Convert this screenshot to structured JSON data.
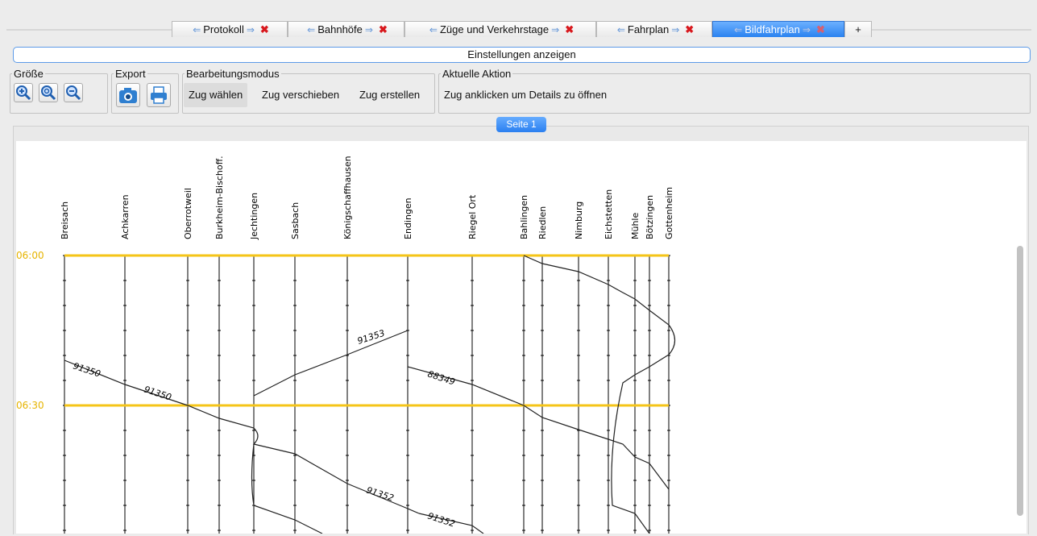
{
  "tabs": [
    {
      "label": "Protokoll"
    },
    {
      "label": "Bahnhöfe"
    },
    {
      "label": "Züge und Verkehrstage"
    },
    {
      "label": "Fahrplan"
    },
    {
      "label": "Bildfahrplan"
    }
  ],
  "add_tab_label": "+",
  "settings_label": "Einstellungen anzeigen",
  "groups": {
    "size": {
      "legend": "Größe"
    },
    "export": {
      "legend": "Export"
    },
    "mode": {
      "legend": "Bearbeitungsmodus",
      "buttons": [
        "Zug wählen",
        "Zug verschieben",
        "Zug erstellen"
      ]
    },
    "action": {
      "legend": "Aktuelle Aktion",
      "text": "Zug anklicken um Details zu öffnen"
    }
  },
  "page_tab": "Seite 1",
  "diagram": {
    "stations": [
      "Breisach",
      "Achkarren",
      "Oberrotweil",
      "Burkheim-Bischoff.",
      "Jechtingen",
      "Sasbach",
      "Königschaffhausen",
      "Endingen",
      "Riegel Ort",
      "Bahlingen",
      "Riedlen",
      "Nimburg",
      "Eichstetten",
      "Mühle",
      "Bötzingen",
      "Gottenheim"
    ],
    "time_labels": [
      "06:00",
      "06:30"
    ],
    "train_numbers": [
      "91350",
      "91350",
      "91353",
      "88349",
      "91352",
      "91352"
    ],
    "colors": {
      "hour_line": "#f5c518",
      "time_text": "#e6b400",
      "track": "#000000"
    }
  }
}
